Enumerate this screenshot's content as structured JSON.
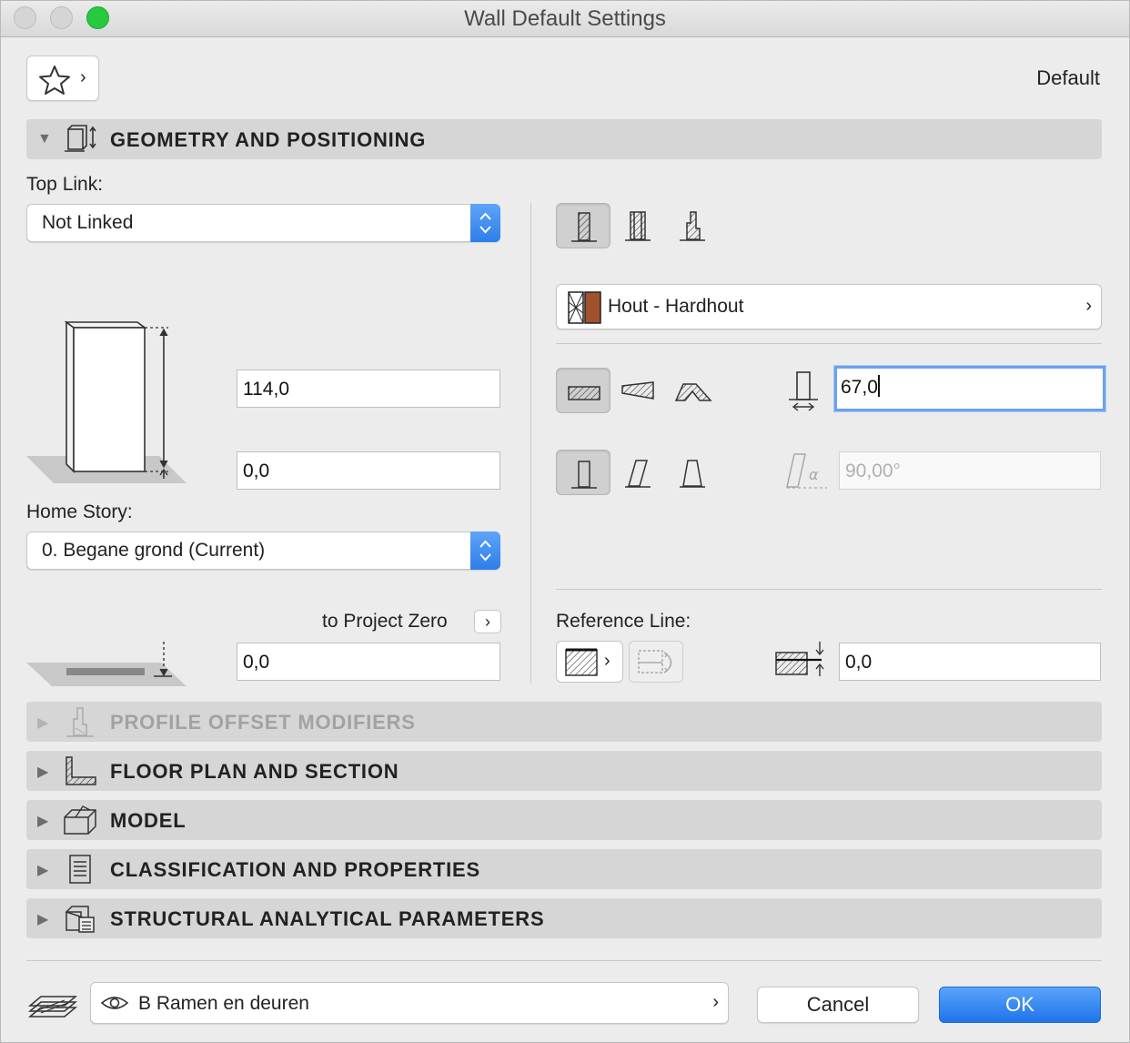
{
  "window": {
    "title": "Wall Default Settings"
  },
  "header": {
    "favorites_icon": "star-icon",
    "default_label": "Default"
  },
  "sections": {
    "geometry": "GEOMETRY AND POSITIONING",
    "profile_offset": "PROFILE OFFSET MODIFIERS",
    "floor_plan": "FLOOR PLAN AND SECTION",
    "model": "MODEL",
    "classification": "CLASSIFICATION AND PROPERTIES",
    "structural": "STRUCTURAL ANALYTICAL PARAMETERS"
  },
  "geometry": {
    "top_link_label": "Top Link:",
    "top_link_value": "Not Linked",
    "height_value": "114,0",
    "bottom_offset_value": "0,0",
    "home_story_label": "Home Story:",
    "home_story_value": "0. Begane grond (Current)",
    "to_project_zero_label": "to Project Zero",
    "project_zero_value": "0,0",
    "material_value": "Hout - Hardhout",
    "material_color": "#a0522d",
    "thickness_value": "67,0",
    "angle_value": "90,00°",
    "reference_line_label": "Reference Line:",
    "reference_offset_value": "0,0"
  },
  "footer": {
    "layer_value": "B Ramen en deuren",
    "cancel_label": "Cancel",
    "ok_label": "OK"
  },
  "colors": {
    "accent": "#2d7ee9",
    "section_header": "#d6d6d6"
  }
}
